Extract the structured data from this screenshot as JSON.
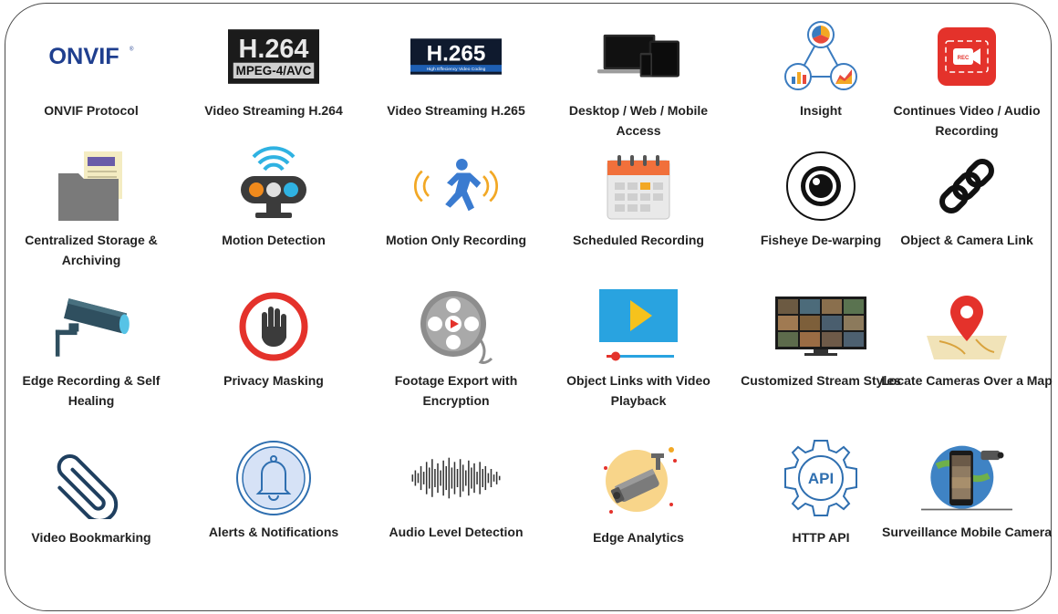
{
  "features": {
    "row1": [
      {
        "label": "ONVIF Protocol",
        "icon": "onvif-logo-icon",
        "logo_text": "ONVIF"
      },
      {
        "label": "Video Streaming H.264",
        "icon": "h264-badge-icon",
        "badge_main": "H.264",
        "badge_sub": "MPEG-4/AVC"
      },
      {
        "label": "Video Streaming H.265",
        "icon": "h265-badge-icon",
        "badge_main": "H.265",
        "badge_sub": "High Effeciency Video Coding"
      },
      {
        "label": "Desktop / Web / Mobile Access",
        "icon": "devices-icon"
      },
      {
        "label": "Insight",
        "icon": "insight-charts-icon"
      },
      {
        "label": "Continues Video / Audio Recording",
        "icon": "rec-camera-icon",
        "badge_text": "REC"
      }
    ],
    "row2": [
      {
        "label": "Centralized Storage & Archiving",
        "icon": "folder-archive-icon"
      },
      {
        "label": "Motion Detection",
        "icon": "motion-sensor-icon"
      },
      {
        "label": "Motion Only Recording",
        "icon": "running-person-icon"
      },
      {
        "label": "Scheduled Recording",
        "icon": "calendar-icon"
      },
      {
        "label": "Fisheye De-warping",
        "icon": "fisheye-lens-icon"
      },
      {
        "label": "Object & Camera Link",
        "icon": "chain-link-icon"
      }
    ],
    "row3": [
      {
        "label": "Edge Recording & Self Healing",
        "icon": "security-camera-icon"
      },
      {
        "label": "Privacy Masking",
        "icon": "stop-hand-icon"
      },
      {
        "label": "Footage Export with Encryption",
        "icon": "film-reel-icon"
      },
      {
        "label": "Object Links with Video Playback",
        "icon": "video-player-icon"
      },
      {
        "label": "Customized Stream Styles",
        "icon": "video-wall-tv-icon"
      },
      {
        "label": "Locate Cameras Over a Map",
        "icon": "map-pin-icon"
      }
    ],
    "row4": [
      {
        "label": "Video Bookmarking",
        "icon": "paperclip-icon"
      },
      {
        "label": "Alerts & Notifications",
        "icon": "bell-icon"
      },
      {
        "label": "Audio Level Detection",
        "icon": "waveform-icon"
      },
      {
        "label": "Edge Analytics",
        "icon": "analytics-camera-icon"
      },
      {
        "label": "HTTP API",
        "icon": "api-gear-icon",
        "badge_text": "API"
      },
      {
        "label": "Surveillance Mobile Camera",
        "icon": "mobile-camera-icon"
      }
    ]
  }
}
